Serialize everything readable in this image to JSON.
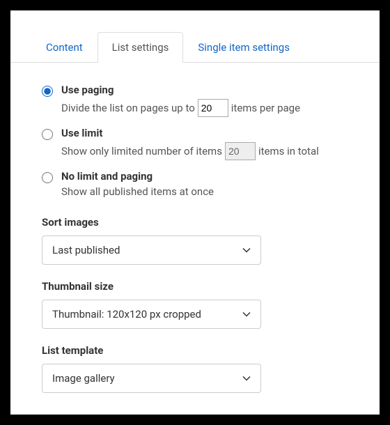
{
  "tabs": {
    "content": "Content",
    "list_settings": "List settings",
    "single_item": "Single item settings"
  },
  "paging_options": {
    "use_paging": {
      "title": "Use paging",
      "desc_prefix": "Divide the list on pages up to",
      "value": "20",
      "desc_suffix": "items per page"
    },
    "use_limit": {
      "title": "Use limit",
      "desc_prefix": "Show only limited number of items",
      "value": "20",
      "desc_suffix": "items in total"
    },
    "no_limit": {
      "title": "No limit and paging",
      "desc": "Show all published items at once"
    }
  },
  "sort_images": {
    "label": "Sort images",
    "value": "Last published"
  },
  "thumbnail_size": {
    "label": "Thumbnail size",
    "value": "Thumbnail: 120x120 px cropped"
  },
  "list_template": {
    "label": "List template",
    "value": "Image gallery"
  }
}
